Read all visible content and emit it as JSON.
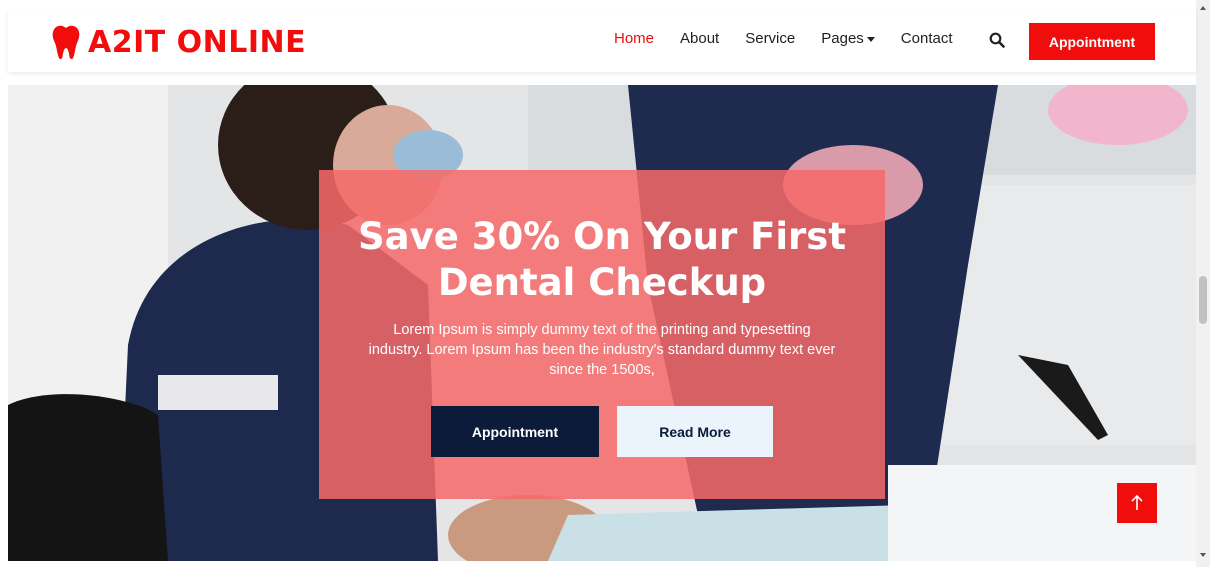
{
  "brand": {
    "name": "A2IT ONLINE",
    "icon": "tooth-icon",
    "color": "#f20d0d"
  },
  "nav": {
    "items": [
      {
        "label": "Home",
        "active": true
      },
      {
        "label": "About"
      },
      {
        "label": "Service"
      },
      {
        "label": "Pages",
        "dropdown": true
      },
      {
        "label": "Contact"
      }
    ],
    "search_icon": "search-icon",
    "cta_label": "Appointment"
  },
  "hero": {
    "headline_line1": "Save 30% On Your First",
    "headline_line2": "Dental Checkup",
    "description": "Lorem Ipsum is simply dummy text of the printing and typesetting industry. Lorem Ipsum has been the industry's standard dummy text ever since the 1500s,",
    "primary_button": "Appointment",
    "secondary_button": "Read More",
    "panel_color": "#f66969"
  },
  "back_to_top_icon": "arrow-up-icon",
  "colors": {
    "accent": "#f20d0d",
    "dark": "#0c1b3a",
    "light": "#eaf4fa"
  }
}
